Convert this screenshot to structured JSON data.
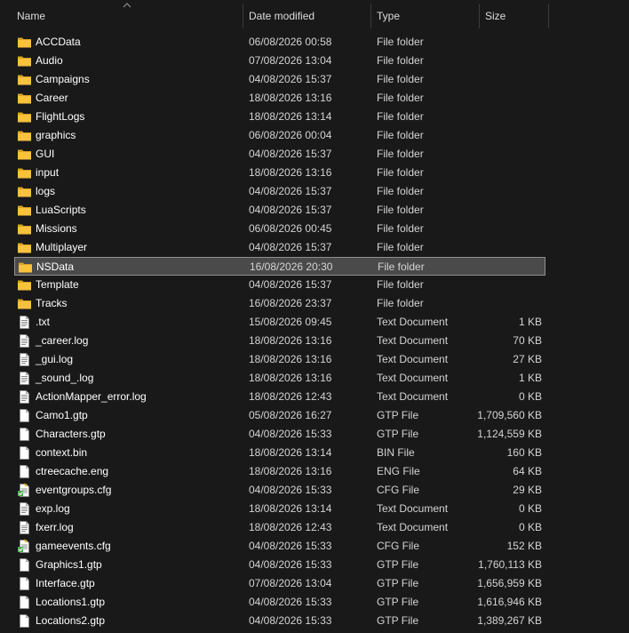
{
  "columns": {
    "name": "Name",
    "date": "Date modified",
    "type": "Type",
    "size": "Size"
  },
  "colors": {
    "background": "#191919",
    "selection_bg": "#4a4a4a",
    "selection_border": "#8f8f8f",
    "folder_yellow": "#f8c23a"
  },
  "selected_row": "NSData",
  "files": [
    {
      "name": "ACCData",
      "date": "06/08/2026 00:58",
      "type": "File folder",
      "size": "",
      "icon": "folder-icon"
    },
    {
      "name": "Audio",
      "date": "07/08/2026 13:04",
      "type": "File folder",
      "size": "",
      "icon": "folder-icon"
    },
    {
      "name": "Campaigns",
      "date": "04/08/2026 15:37",
      "type": "File folder",
      "size": "",
      "icon": "folder-icon"
    },
    {
      "name": "Career",
      "date": "18/08/2026 13:16",
      "type": "File folder",
      "size": "",
      "icon": "folder-icon"
    },
    {
      "name": "FlightLogs",
      "date": "18/08/2026 13:14",
      "type": "File folder",
      "size": "",
      "icon": "folder-icon"
    },
    {
      "name": "graphics",
      "date": "06/08/2026 00:04",
      "type": "File folder",
      "size": "",
      "icon": "folder-icon"
    },
    {
      "name": "GUI",
      "date": "04/08/2026 15:37",
      "type": "File folder",
      "size": "",
      "icon": "folder-icon"
    },
    {
      "name": "input",
      "date": "18/08/2026 13:16",
      "type": "File folder",
      "size": "",
      "icon": "folder-icon"
    },
    {
      "name": "logs",
      "date": "04/08/2026 15:37",
      "type": "File folder",
      "size": "",
      "icon": "folder-icon"
    },
    {
      "name": "LuaScripts",
      "date": "04/08/2026 15:37",
      "type": "File folder",
      "size": "",
      "icon": "folder-icon"
    },
    {
      "name": "Missions",
      "date": "06/08/2026 00:45",
      "type": "File folder",
      "size": "",
      "icon": "folder-icon"
    },
    {
      "name": "Multiplayer",
      "date": "04/08/2026 15:37",
      "type": "File folder",
      "size": "",
      "icon": "folder-icon"
    },
    {
      "name": "NSData",
      "date": "16/08/2026 20:30",
      "type": "File folder",
      "size": "",
      "icon": "folder-icon"
    },
    {
      "name": "Template",
      "date": "04/08/2026 15:37",
      "type": "File folder",
      "size": "",
      "icon": "folder-icon"
    },
    {
      "name": "Tracks",
      "date": "16/08/2026 23:37",
      "type": "File folder",
      "size": "",
      "icon": "folder-icon"
    },
    {
      "name": ".txt",
      "date": "15/08/2026 09:45",
      "type": "Text Document",
      "size": "1 KB",
      "icon": "text-document-icon"
    },
    {
      "name": "_career.log",
      "date": "18/08/2026 13:16",
      "type": "Text Document",
      "size": "70 KB",
      "icon": "text-document-icon"
    },
    {
      "name": "_gui.log",
      "date": "18/08/2026 13:16",
      "type": "Text Document",
      "size": "27 KB",
      "icon": "text-document-icon"
    },
    {
      "name": "_sound_.log",
      "date": "18/08/2026 13:16",
      "type": "Text Document",
      "size": "1 KB",
      "icon": "text-document-icon"
    },
    {
      "name": "ActionMapper_error.log",
      "date": "18/08/2026 12:43",
      "type": "Text Document",
      "size": "0 KB",
      "icon": "text-document-icon"
    },
    {
      "name": "Camo1.gtp",
      "date": "05/08/2026 16:27",
      "type": "GTP File",
      "size": "1,709,560 KB",
      "icon": "blank-file-icon"
    },
    {
      "name": "Characters.gtp",
      "date": "04/08/2026 15:33",
      "type": "GTP File",
      "size": "1,124,559 KB",
      "icon": "blank-file-icon"
    },
    {
      "name": "context.bin",
      "date": "18/08/2026 13:14",
      "type": "BIN File",
      "size": "160 KB",
      "icon": "blank-file-icon"
    },
    {
      "name": "ctreecache.eng",
      "date": "18/08/2026 13:16",
      "type": "ENG File",
      "size": "64 KB",
      "icon": "blank-file-icon"
    },
    {
      "name": "eventgroups.cfg",
      "date": "04/08/2026 15:33",
      "type": "CFG File",
      "size": "29 KB",
      "icon": "config-file-icon"
    },
    {
      "name": "exp.log",
      "date": "18/08/2026 13:14",
      "type": "Text Document",
      "size": "0 KB",
      "icon": "text-document-icon"
    },
    {
      "name": "fxerr.log",
      "date": "18/08/2026 12:43",
      "type": "Text Document",
      "size": "0 KB",
      "icon": "text-document-icon"
    },
    {
      "name": "gameevents.cfg",
      "date": "04/08/2026 15:33",
      "type": "CFG File",
      "size": "152 KB",
      "icon": "config-file-icon"
    },
    {
      "name": "Graphics1.gtp",
      "date": "04/08/2026 15:33",
      "type": "GTP File",
      "size": "1,760,113 KB",
      "icon": "blank-file-icon"
    },
    {
      "name": "Interface.gtp",
      "date": "07/08/2026 13:04",
      "type": "GTP File",
      "size": "1,656,959 KB",
      "icon": "blank-file-icon"
    },
    {
      "name": "Locations1.gtp",
      "date": "04/08/2026 15:33",
      "type": "GTP File",
      "size": "1,616,946 KB",
      "icon": "blank-file-icon"
    },
    {
      "name": "Locations2.gtp",
      "date": "04/08/2026 15:33",
      "type": "GTP File",
      "size": "1,389,267 KB",
      "icon": "blank-file-icon"
    }
  ]
}
